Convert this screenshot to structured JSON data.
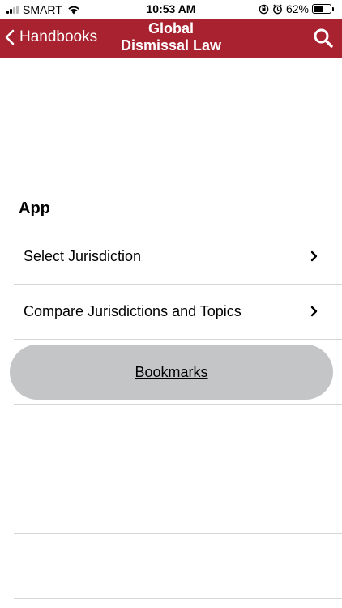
{
  "status": {
    "carrier": "SMART",
    "time": "10:53 AM",
    "battery": "62%",
    "battery_level": 0.62
  },
  "nav": {
    "back_label": "Handbooks",
    "title_line1": "Global",
    "title_line2": "Dismissal Law",
    "search_icon": "search-icon"
  },
  "section": {
    "title": "App"
  },
  "rows": [
    {
      "label": "Select Jurisdiction"
    },
    {
      "label": "Compare Jurisdictions and Topics"
    }
  ],
  "bookmarks": {
    "label": "Bookmarks"
  },
  "colors": {
    "nav_background": "#a8232f",
    "button_background": "#c4c5c7"
  }
}
